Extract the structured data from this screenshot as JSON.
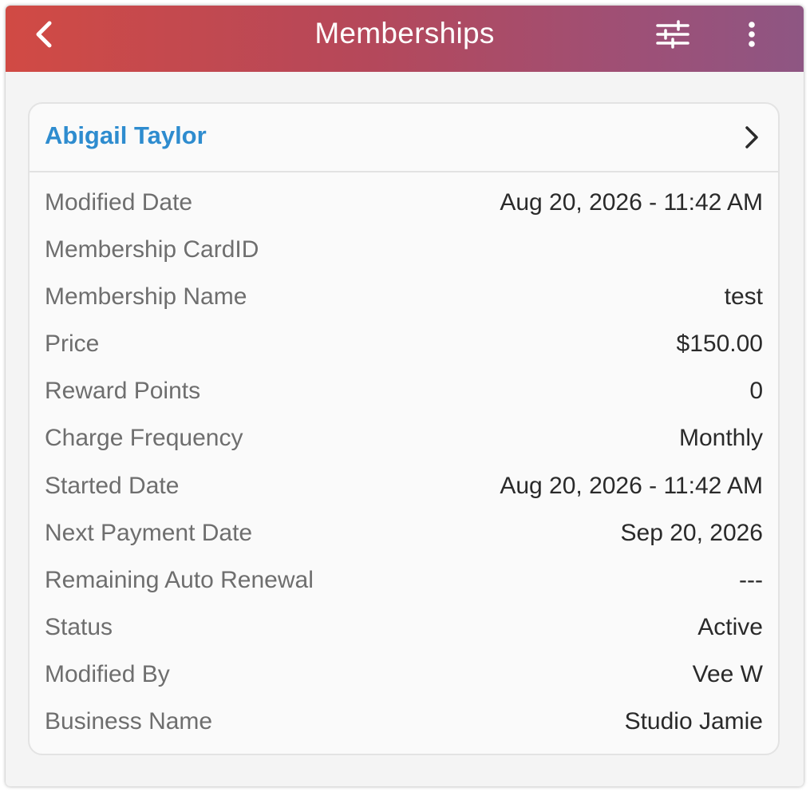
{
  "header": {
    "title": "Memberships",
    "back_icon": "chevron-left-icon",
    "filter_icon": "sliders-icon",
    "more_icon": "more-vertical-icon",
    "gradient_start": "#d14a44",
    "gradient_end": "#8e5683"
  },
  "membership": {
    "customer_name": "Abigail Taylor",
    "name_color": "#2e8ccf",
    "details": [
      {
        "label": "Modified Date",
        "value": "Aug 20, 2026 - 11:42 AM"
      },
      {
        "label": "Membership CardID",
        "value": ""
      },
      {
        "label": "Membership Name",
        "value": "test"
      },
      {
        "label": "Price",
        "value": "$150.00"
      },
      {
        "label": "Reward Points",
        "value": "0"
      },
      {
        "label": "Charge Frequency",
        "value": "Monthly"
      },
      {
        "label": "Started Date",
        "value": "Aug 20, 2026 - 11:42 AM"
      },
      {
        "label": "Next Payment Date",
        "value": "Sep 20, 2026"
      },
      {
        "label": "Remaining Auto Renewal",
        "value": "---"
      },
      {
        "label": "Status",
        "value": "Active"
      },
      {
        "label": "Modified By",
        "value": "Vee W"
      },
      {
        "label": "Business Name",
        "value": "Studio Jamie"
      }
    ]
  }
}
